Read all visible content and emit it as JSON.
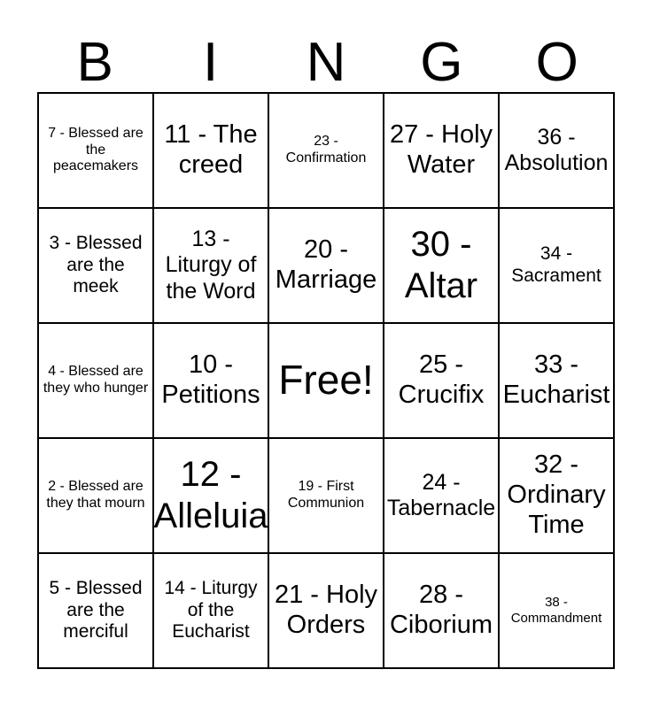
{
  "card": {
    "header_letters": [
      "B",
      "I",
      "N",
      "G",
      "O"
    ],
    "columns": [
      {
        "letter": "B",
        "cells": [
          {
            "text": "7 - Blessed are the peacemakers",
            "size": "xxs"
          },
          {
            "text": "3 - Blessed are the meek",
            "size": "xs"
          },
          {
            "text": "4 - Blessed are they who hunger",
            "size": "xxs"
          },
          {
            "text": "2 - Blessed are they that mourn",
            "size": "xxs"
          },
          {
            "text": "5 - Blessed are the merciful",
            "size": "xs"
          }
        ]
      },
      {
        "letter": "I",
        "cells": [
          {
            "text": "11 - The creed",
            "size": "md"
          },
          {
            "text": "13 - Liturgy of the Word",
            "size": "sm"
          },
          {
            "text": "10 - Petitions",
            "size": "md"
          },
          {
            "text": "12 - Alleluia",
            "size": "lg"
          },
          {
            "text": "14 - Liturgy of the Eucharist",
            "size": "xs"
          }
        ]
      },
      {
        "letter": "N",
        "cells": [
          {
            "text": "23 - Confirmation",
            "size": "xxs"
          },
          {
            "text": "20 - Marriage",
            "size": "md"
          },
          {
            "text": "Free!",
            "size": "xl"
          },
          {
            "text": "19 - First Communion",
            "size": "xxs"
          },
          {
            "text": "21 - Holy Orders",
            "size": "md"
          }
        ]
      },
      {
        "letter": "G",
        "cells": [
          {
            "text": "27 - Holy Water",
            "size": "md"
          },
          {
            "text": "30 - Altar",
            "size": "lg"
          },
          {
            "text": "25 - Crucifix",
            "size": "md"
          },
          {
            "text": "24 - Tabernacle",
            "size": "sm"
          },
          {
            "text": "28 - Ciborium",
            "size": "md"
          }
        ]
      },
      {
        "letter": "O",
        "cells": [
          {
            "text": "36 - Absolution",
            "size": "sm"
          },
          {
            "text": "34 - Sacrament",
            "size": "xs"
          },
          {
            "text": "33 - Eucharist",
            "size": "md"
          },
          {
            "text": "32 - Ordinary Time",
            "size": "md"
          },
          {
            "text": "38 - Commandment",
            "size": "tiny"
          }
        ]
      }
    ]
  }
}
